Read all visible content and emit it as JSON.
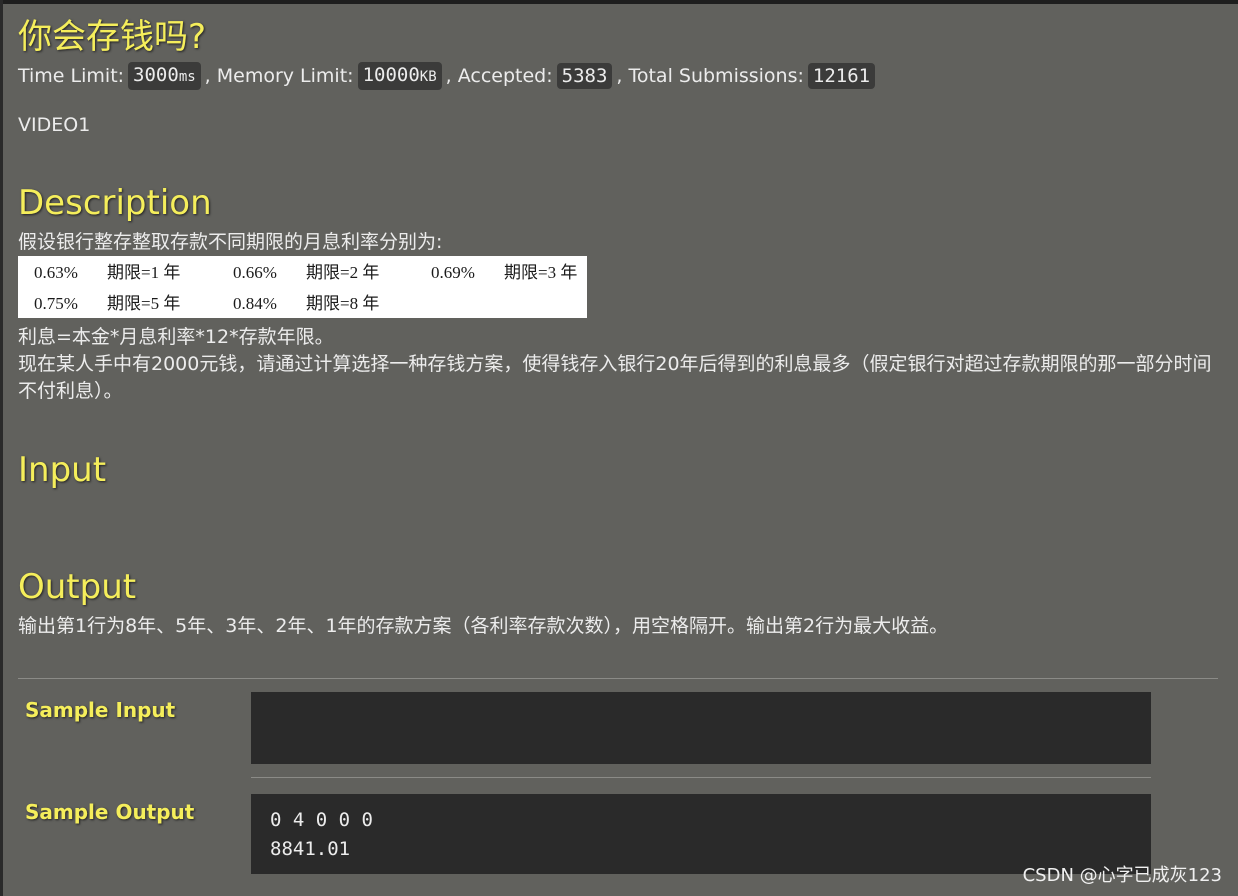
{
  "problem": {
    "title": "你会存钱吗?",
    "limits": {
      "time_label": "Time Limit:",
      "time_value": "3000",
      "time_unit": "ms",
      "memory_label": ", Memory Limit:",
      "memory_value": "10000",
      "memory_unit": "KB",
      "accepted_label": ", Accepted:",
      "accepted_value": "5383",
      "submissions_label": ", Total Submissions:",
      "submissions_value": "12161"
    },
    "source": "VIDEO1"
  },
  "description": {
    "heading": "Description",
    "intro": "假设银行整存整取存款不同期限的月息利率分别为:",
    "rates": [
      {
        "rate": "0.63%",
        "term": "期限=1 年"
      },
      {
        "rate": "0.66%",
        "term": "期限=2 年"
      },
      {
        "rate": "0.69%",
        "term": "期限=3 年"
      },
      {
        "rate": "0.75%",
        "term": "期限=5 年"
      },
      {
        "rate": "0.84%",
        "term": "期限=8 年"
      }
    ],
    "formula": "利息=本金*月息利率*12*存款年限。",
    "task": "现在某人手中有2000元钱，请通过计算选择一种存钱方案，使得钱存入银行20年后得到的利息最多（假定银行对超过存款期限的那一部分时间不付利息）。"
  },
  "input": {
    "heading": "Input"
  },
  "output": {
    "heading": "Output",
    "text": "输出第1行为8年、5年、3年、2年、1年的存款方案（各利率存款次数），用空格隔开。输出第2行为最大收益。"
  },
  "samples": {
    "input_label": "Sample Input",
    "input_value": "",
    "output_label": "Sample Output",
    "output_value": "0 4 0 0 0\n8841.01"
  },
  "watermark": "CSDN @心字已成灰123",
  "colors": {
    "page_bg": "#61615d",
    "heading": "#f5ee5b",
    "code_bg": "#2a2a2a"
  }
}
